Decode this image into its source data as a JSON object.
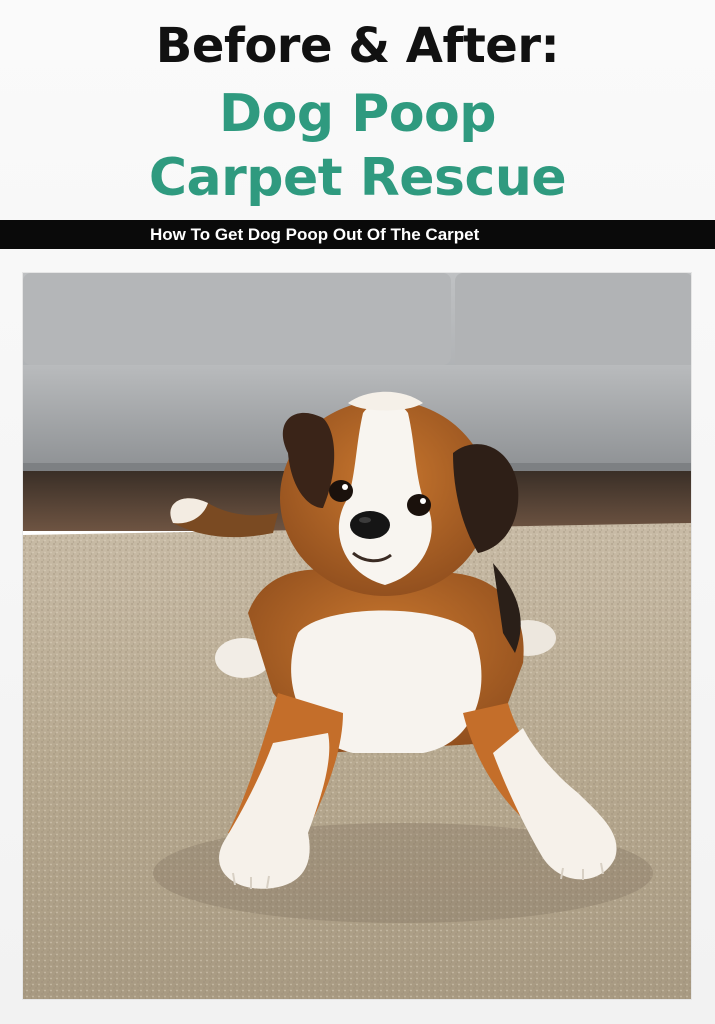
{
  "header": {
    "line1": "Before & After:",
    "line2": "Dog Poop",
    "line3": "Carpet Rescue"
  },
  "banner": {
    "text": "How To Get Dog Poop Out Of The Carpet"
  },
  "colors": {
    "accent": "#2f9a7f",
    "heading": "#111111",
    "banner_bg": "#0a0a0a",
    "banner_text": "#ffffff"
  },
  "image": {
    "subject": "dog-on-carpet-photo"
  }
}
